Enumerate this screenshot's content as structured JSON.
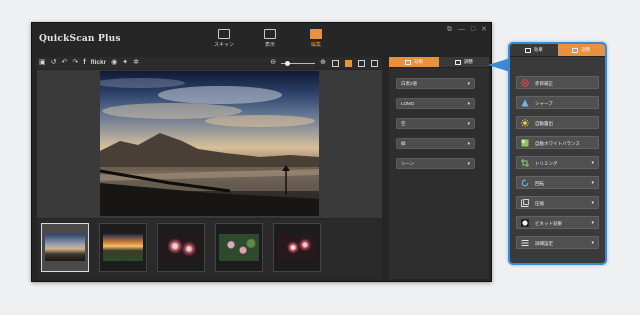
{
  "app": {
    "title": "QuickScan Plus",
    "window_controls": [
      "⧉",
      "—",
      "□",
      "✕"
    ]
  },
  "modes": [
    {
      "label": "スキャン",
      "icon": "scanner-icon",
      "active": false
    },
    {
      "label": "表示",
      "icon": "view-grid-icon",
      "active": false
    },
    {
      "label": "編集",
      "icon": "edit-photo-icon",
      "active": true
    }
  ],
  "toolbar": {
    "flickr_label": "flickr",
    "icons": [
      "save-icon",
      "rotate-left-icon",
      "undo-icon",
      "redo-icon",
      "facebook-icon",
      "flickr-icon",
      "picasa-icon",
      "twitter-icon",
      "settings-icon"
    ],
    "view_icons": [
      "grid-view-icon",
      "single-view-icon",
      "compare-view-icon",
      "dual-view-icon"
    ]
  },
  "panel": {
    "tabs": [
      {
        "label": "効果",
        "icon": "image-icon",
        "active": true
      },
      {
        "label": "調整",
        "icon": "adjust-icon",
        "active": false
      }
    ],
    "dropdowns": [
      {
        "label": "白黒2値"
      },
      {
        "label": "LOMO"
      },
      {
        "label": "空"
      },
      {
        "label": "緑"
      },
      {
        "label": "シーン"
      }
    ]
  },
  "popout": {
    "tabs": [
      {
        "label": "効果",
        "icon": "image-icon",
        "active": false
      },
      {
        "label": "調整",
        "icon": "adjust-icon",
        "active": true
      }
    ],
    "buttons": [
      {
        "label": "赤目補正",
        "icon": "red-eye-icon",
        "has_dropdown": false
      },
      {
        "label": "シャープ",
        "icon": "sharpen-icon",
        "has_dropdown": false
      },
      {
        "label": "自動露出",
        "icon": "auto-exposure-icon",
        "has_dropdown": false
      },
      {
        "label": "自動ホワイトバランス",
        "icon": "white-balance-icon",
        "has_dropdown": false
      },
      {
        "label": "トリミング",
        "icon": "crop-icon",
        "has_dropdown": true
      },
      {
        "label": "回転",
        "icon": "rotate-icon",
        "has_dropdown": true
      },
      {
        "label": "圧縮",
        "icon": "compress-icon",
        "has_dropdown": true
      },
      {
        "label": "ビネット効果",
        "icon": "vignette-icon",
        "has_dropdown": true
      },
      {
        "label": "詳細設定",
        "icon": "settings-list-icon",
        "has_dropdown": true
      }
    ]
  },
  "colors": {
    "accent": "#e8913f",
    "highlight": "#3a8ad6",
    "window_bg": "#252525",
    "panel_bg": "#2e2e2e"
  }
}
